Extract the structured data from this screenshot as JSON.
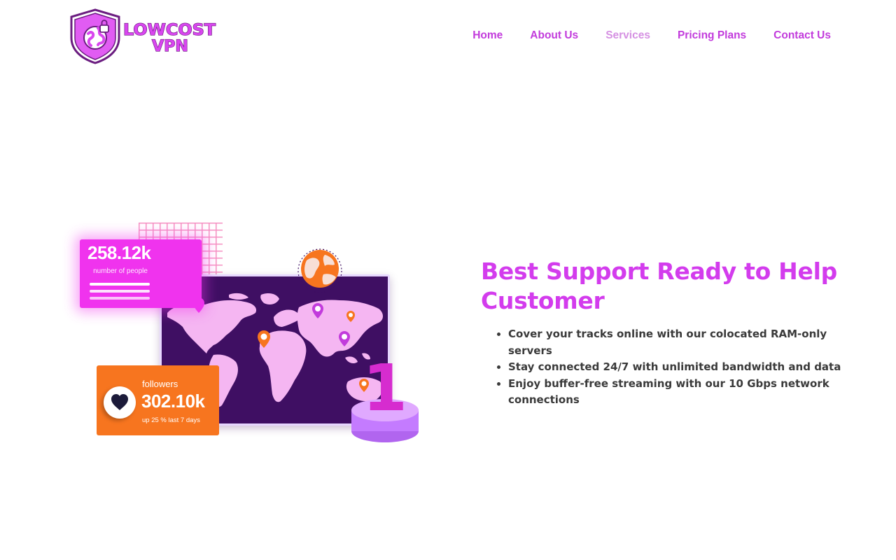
{
  "colors": {
    "brand": "#d946ef",
    "nav_link": "#c23bdc",
    "nav_active": "#d590e2",
    "heading": "#d33ced",
    "body_text": "#3a3a3a",
    "magenta_card": "#f033ee",
    "orange_card": "#f7751f",
    "map_bg": "#3f0f63",
    "podium": "#c47bff"
  },
  "logo": {
    "line1": "LOWCOST",
    "line2": "VPN",
    "icon": "shield-globe-lock-icon"
  },
  "nav": {
    "items": [
      {
        "label": "Home",
        "active": false
      },
      {
        "label": "About Us",
        "active": false
      },
      {
        "label": "Services",
        "active": true
      },
      {
        "label": "Pricing Plans",
        "active": false
      },
      {
        "label": "Contact Us",
        "active": false
      }
    ]
  },
  "illustration": {
    "stat_card": {
      "value": "258.12k",
      "label": "number of people"
    },
    "followers_card": {
      "label": "followers",
      "value": "302.10k",
      "subtext": "up 25 % last 7 days",
      "icon": "heart-icon"
    },
    "podium_number": "1",
    "map_icon": "world-map-icon",
    "globe_icon": "globe-icon"
  },
  "content": {
    "heading": "Best Support Ready to Help Customer",
    "features": [
      "Cover your tracks online with our colocated RAM-only servers",
      "Stay connected 24/7 with unlimited bandwidth and data",
      "Enjoy buffer-free streaming with our 10 Gbps network connections"
    ]
  }
}
